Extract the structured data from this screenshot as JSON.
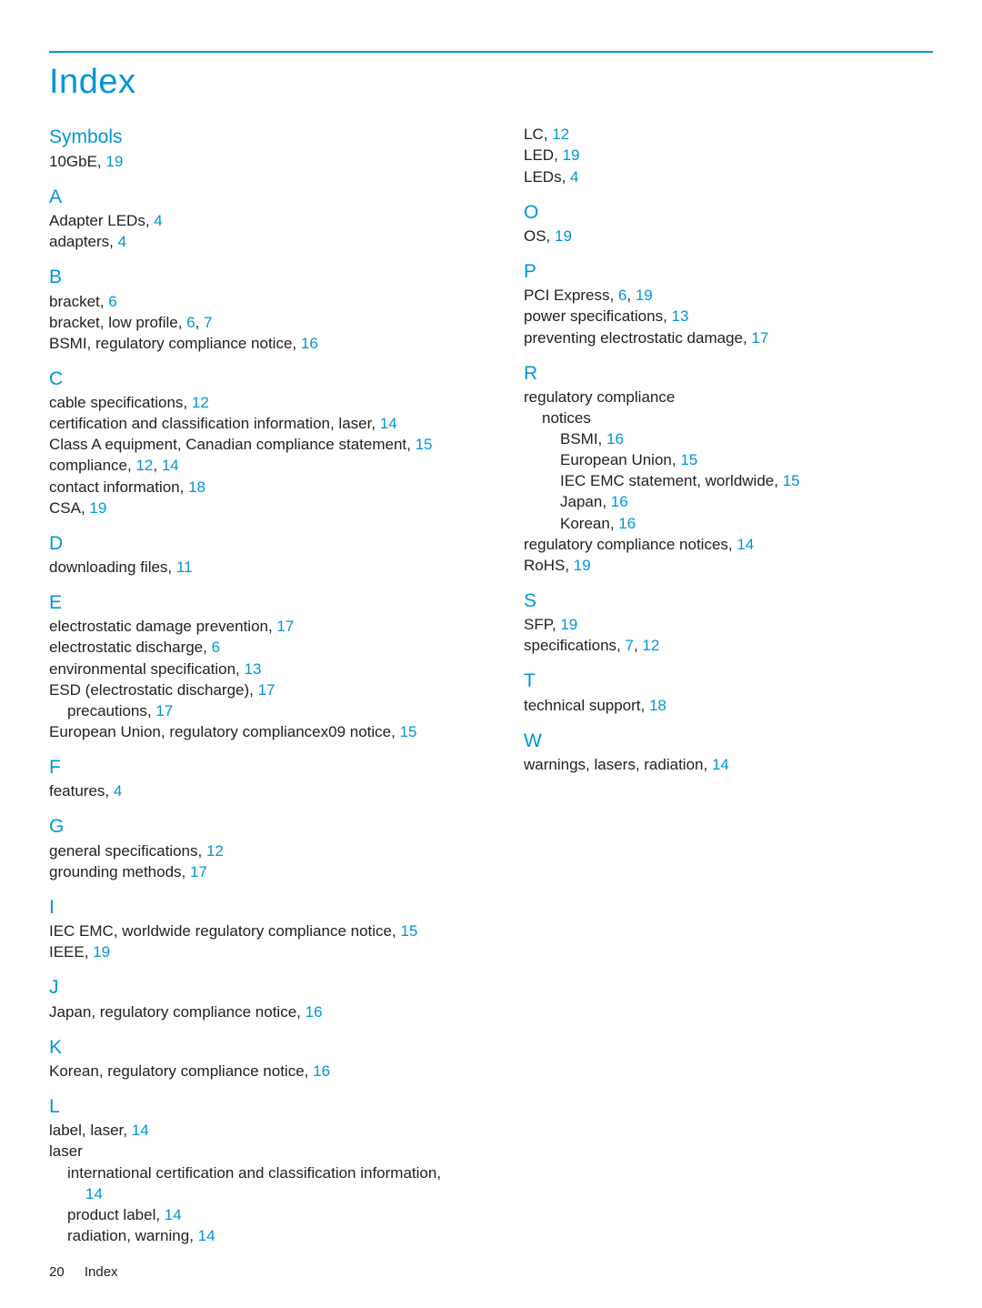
{
  "title": "Index",
  "footer": {
    "page": "20",
    "section": "Index"
  },
  "left": [
    {
      "type": "head",
      "text": "Symbols",
      "first": true
    },
    {
      "type": "entry",
      "text": "10GbE, ",
      "pages": [
        "19"
      ]
    },
    {
      "type": "head",
      "text": "A"
    },
    {
      "type": "entry",
      "text": "Adapter LEDs, ",
      "pages": [
        "4"
      ]
    },
    {
      "type": "entry",
      "text": "adapters, ",
      "pages": [
        "4"
      ]
    },
    {
      "type": "head",
      "text": "B"
    },
    {
      "type": "entry",
      "text": "bracket, ",
      "pages": [
        "6"
      ]
    },
    {
      "type": "entry",
      "text": "bracket, low profile, ",
      "pages": [
        "6",
        "7"
      ]
    },
    {
      "type": "entry",
      "text": "BSMI, regulatory compliance notice, ",
      "pages": [
        "16"
      ]
    },
    {
      "type": "head",
      "text": "C"
    },
    {
      "type": "entry",
      "text": "cable specifications, ",
      "pages": [
        "12"
      ]
    },
    {
      "type": "entry",
      "text": "certification and classification information, laser, ",
      "pages": [
        "14"
      ]
    },
    {
      "type": "entry",
      "text": "Class A equipment, Canadian compliance statement, ",
      "pages": [
        "15"
      ]
    },
    {
      "type": "entry",
      "text": "compliance, ",
      "pages": [
        "12",
        "14"
      ]
    },
    {
      "type": "entry",
      "text": "contact information, ",
      "pages": [
        "18"
      ]
    },
    {
      "type": "entry",
      "text": "CSA, ",
      "pages": [
        "19"
      ]
    },
    {
      "type": "head",
      "text": "D"
    },
    {
      "type": "entry",
      "text": "downloading files, ",
      "pages": [
        "11"
      ]
    },
    {
      "type": "head",
      "text": "E"
    },
    {
      "type": "entry",
      "text": "electrostatic damage prevention, ",
      "pages": [
        "17"
      ]
    },
    {
      "type": "entry",
      "text": "electrostatic discharge, ",
      "pages": [
        "6"
      ]
    },
    {
      "type": "entry",
      "text": "environmental specification, ",
      "pages": [
        "13"
      ]
    },
    {
      "type": "entry",
      "text": "ESD (electrostatic discharge), ",
      "pages": [
        "17"
      ]
    },
    {
      "type": "entry",
      "indent": 1,
      "text": "precautions, ",
      "pages": [
        "17"
      ]
    },
    {
      "type": "entry",
      "text": "European Union, regulatory compliancex09 notice, ",
      "pages": [
        "15"
      ]
    },
    {
      "type": "head",
      "text": "F"
    },
    {
      "type": "entry",
      "text": "features, ",
      "pages": [
        "4"
      ]
    },
    {
      "type": "head",
      "text": "G"
    },
    {
      "type": "entry",
      "text": "general specifications, ",
      "pages": [
        "12"
      ]
    },
    {
      "type": "entry",
      "text": "grounding methods, ",
      "pages": [
        "17"
      ]
    },
    {
      "type": "head",
      "text": "I"
    },
    {
      "type": "entry",
      "text": "IEC EMC, worldwide regulatory compliance notice, ",
      "pages": [
        "15"
      ]
    },
    {
      "type": "entry",
      "text": "IEEE, ",
      "pages": [
        "19"
      ]
    },
    {
      "type": "head",
      "text": "J"
    },
    {
      "type": "entry",
      "text": "Japan, regulatory compliance notice, ",
      "pages": [
        "16"
      ]
    },
    {
      "type": "head",
      "text": "K"
    },
    {
      "type": "entry",
      "text": "Korean, regulatory compliance notice, ",
      "pages": [
        "16"
      ]
    },
    {
      "type": "head",
      "text": "L"
    },
    {
      "type": "entry",
      "text": "label, laser, ",
      "pages": [
        "14"
      ]
    },
    {
      "type": "entry",
      "text": "laser"
    },
    {
      "type": "entry",
      "indent": 1,
      "text": "international certification and classification information,"
    },
    {
      "type": "entry",
      "indent": 2,
      "text": "",
      "pages": [
        "14"
      ]
    },
    {
      "type": "entry",
      "indent": 1,
      "text": "product label, ",
      "pages": [
        "14"
      ]
    },
    {
      "type": "entry",
      "indent": 1,
      "text": "radiation, warning, ",
      "pages": [
        "14"
      ]
    }
  ],
  "right": [
    {
      "type": "entry",
      "text": "LC, ",
      "pages": [
        "12"
      ]
    },
    {
      "type": "entry",
      "text": "LED, ",
      "pages": [
        "19"
      ]
    },
    {
      "type": "entry",
      "text": "LEDs, ",
      "pages": [
        "4"
      ]
    },
    {
      "type": "head",
      "text": "O"
    },
    {
      "type": "entry",
      "text": "OS, ",
      "pages": [
        "19"
      ]
    },
    {
      "type": "head",
      "text": "P"
    },
    {
      "type": "entry",
      "text": "PCI Express, ",
      "pages": [
        "6",
        "19"
      ]
    },
    {
      "type": "entry",
      "text": "power specifications, ",
      "pages": [
        "13"
      ]
    },
    {
      "type": "entry",
      "text": "preventing electrostatic damage, ",
      "pages": [
        "17"
      ]
    },
    {
      "type": "head",
      "text": "R"
    },
    {
      "type": "entry",
      "text": "regulatory compliance"
    },
    {
      "type": "entry",
      "indent": 1,
      "text": "notices"
    },
    {
      "type": "entry",
      "indent": 2,
      "text": "BSMI, ",
      "pages": [
        "16"
      ]
    },
    {
      "type": "entry",
      "indent": 2,
      "text": "European Union, ",
      "pages": [
        "15"
      ]
    },
    {
      "type": "entry",
      "indent": 2,
      "text": "IEC EMC statement, worldwide, ",
      "pages": [
        "15"
      ]
    },
    {
      "type": "entry",
      "indent": 2,
      "text": "Japan, ",
      "pages": [
        "16"
      ]
    },
    {
      "type": "entry",
      "indent": 2,
      "text": "Korean, ",
      "pages": [
        "16"
      ]
    },
    {
      "type": "entry",
      "text": "regulatory compliance notices, ",
      "pages": [
        "14"
      ]
    },
    {
      "type": "entry",
      "text": "RoHS, ",
      "pages": [
        "19"
      ]
    },
    {
      "type": "head",
      "text": "S"
    },
    {
      "type": "entry",
      "text": "SFP, ",
      "pages": [
        "19"
      ]
    },
    {
      "type": "entry",
      "text": "specifications, ",
      "pages": [
        "7",
        "12"
      ]
    },
    {
      "type": "head",
      "text": "T"
    },
    {
      "type": "entry",
      "text": "technical support, ",
      "pages": [
        "18"
      ]
    },
    {
      "type": "head",
      "text": "W"
    },
    {
      "type": "entry",
      "text": "warnings, lasers, radiation, ",
      "pages": [
        "14"
      ]
    }
  ]
}
